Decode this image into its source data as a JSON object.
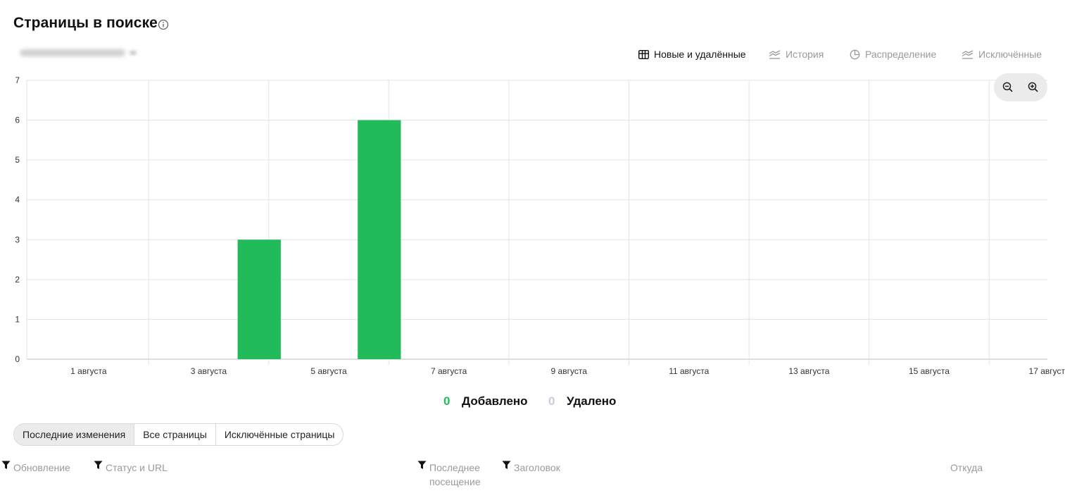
{
  "page": {
    "title": "Страницы в поиске",
    "host_selector": "••••••••••••••••••••"
  },
  "view_tabs": [
    {
      "label": "Новые и удалённые",
      "icon": "table-icon",
      "active": true
    },
    {
      "label": "История",
      "icon": "area-chart-icon",
      "active": false
    },
    {
      "label": "Распределение",
      "icon": "pie-chart-icon",
      "active": false
    },
    {
      "label": "Исключённые",
      "icon": "area-chart-icon",
      "active": false
    }
  ],
  "zoom": {
    "zoom_out_icon": "zoom-out-icon",
    "zoom_in_icon": "zoom-in-icon"
  },
  "colors": {
    "added": "#22bb5a",
    "removed": "#c5cdd8",
    "grid": "#e3e3e3"
  },
  "chart_data": {
    "type": "bar",
    "title": "",
    "xlabel": "",
    "ylabel": "",
    "ylim": [
      0,
      7
    ],
    "yticks": [
      0,
      1,
      2,
      3,
      4,
      5,
      6,
      7
    ],
    "x_tick_labels": [
      "1 августа",
      "3 августа",
      "5 августа",
      "7 августа",
      "9 августа",
      "11 августа",
      "13 августа",
      "15 августа",
      "17 августа"
    ],
    "categories": [
      "1 августа",
      "2 августа",
      "3 августа",
      "4 августа",
      "5 августа",
      "6 августа",
      "7 августа",
      "8 августа",
      "9 августа",
      "10 августа",
      "11 августа",
      "12 августа",
      "13 августа",
      "14 августа",
      "15 августа",
      "16 августа",
      "17 августа"
    ],
    "series": [
      {
        "name": "Добавлено",
        "values": [
          0,
          0,
          0,
          3,
          0,
          6,
          0,
          0,
          0,
          0,
          0,
          0,
          0,
          0,
          0,
          0,
          0
        ]
      }
    ],
    "grid": true
  },
  "legend": {
    "added_count": "0",
    "added_label": "Добавлено",
    "removed_count": "0",
    "removed_label": "Удалено"
  },
  "tabs": [
    {
      "label": "Последние изменения",
      "active": true
    },
    {
      "label": "Все страницы",
      "active": false
    },
    {
      "label": "Исключённые страницы",
      "active": false
    }
  ],
  "columns": {
    "updated": "Обновление",
    "status_url": "Статус и URL",
    "last_visit_1": "Последнее",
    "last_visit_2": "посещение",
    "title": "Заголовок",
    "source": "Откуда"
  }
}
